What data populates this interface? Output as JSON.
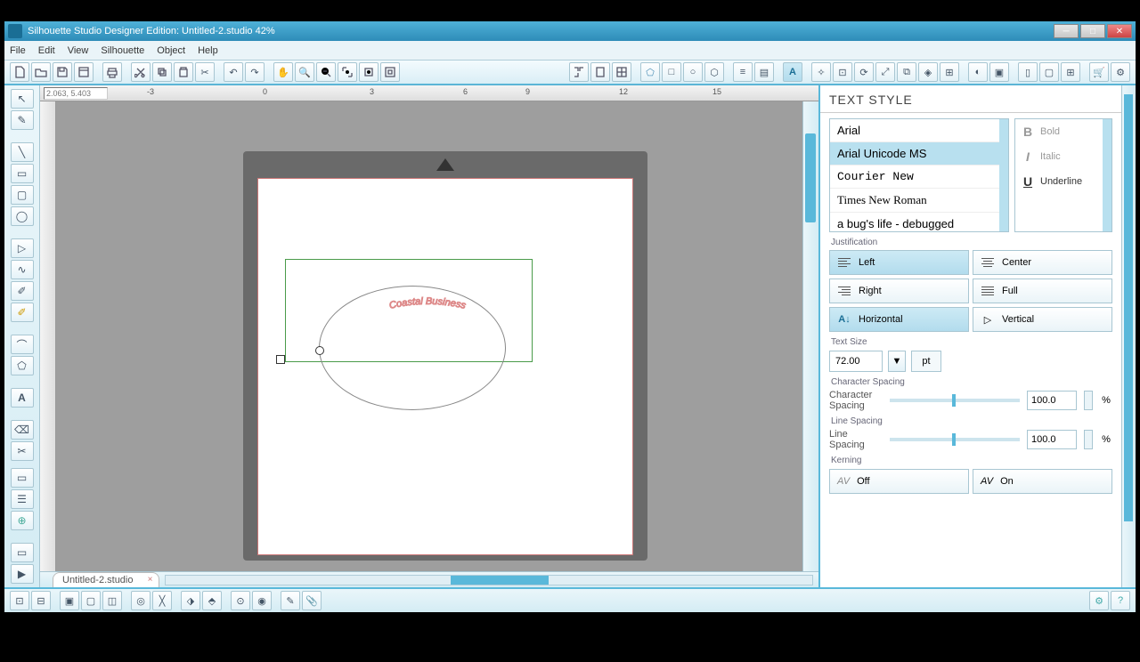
{
  "title": "Silhouette Studio Designer Edition: Untitled-2.studio 42%",
  "menu": [
    "File",
    "Edit",
    "View",
    "Silhouette",
    "Object",
    "Help"
  ],
  "coord": "2.063, 5.403",
  "ruler_marks": [
    "-3",
    "0",
    "3",
    "6",
    "9",
    "12",
    "15"
  ],
  "tab": "Untitled-2.studio",
  "canvas_text": "Coastal Business",
  "panel": {
    "title": "TEXT STYLE",
    "fonts": [
      "Arial",
      "Arial Unicode MS",
      "Courier New",
      "Times New Roman",
      "a bug's life - debugged"
    ],
    "styles": [
      {
        "icon": "B",
        "label": "Bold"
      },
      {
        "icon": "I",
        "label": "Italic"
      },
      {
        "icon": "U",
        "label": "Underline"
      }
    ],
    "justification_label": "Justification",
    "justify": {
      "left": "Left",
      "center": "Center",
      "right": "Right",
      "full": "Full"
    },
    "orient": {
      "h": "Horizontal",
      "v": "Vertical"
    },
    "textsize_label": "Text Size",
    "textsize": "72.00",
    "unit": "pt",
    "charspacing_label": "Character Spacing",
    "charspacing_row": "Character Spacing",
    "charspacing_val": "100.0",
    "linespacing_label": "Line Spacing",
    "linespacing_row": "Line Spacing",
    "linespacing_val": "100.0",
    "pct": "%",
    "kerning_label": "Kerning",
    "kern_off": "Off",
    "kern_on": "On"
  }
}
